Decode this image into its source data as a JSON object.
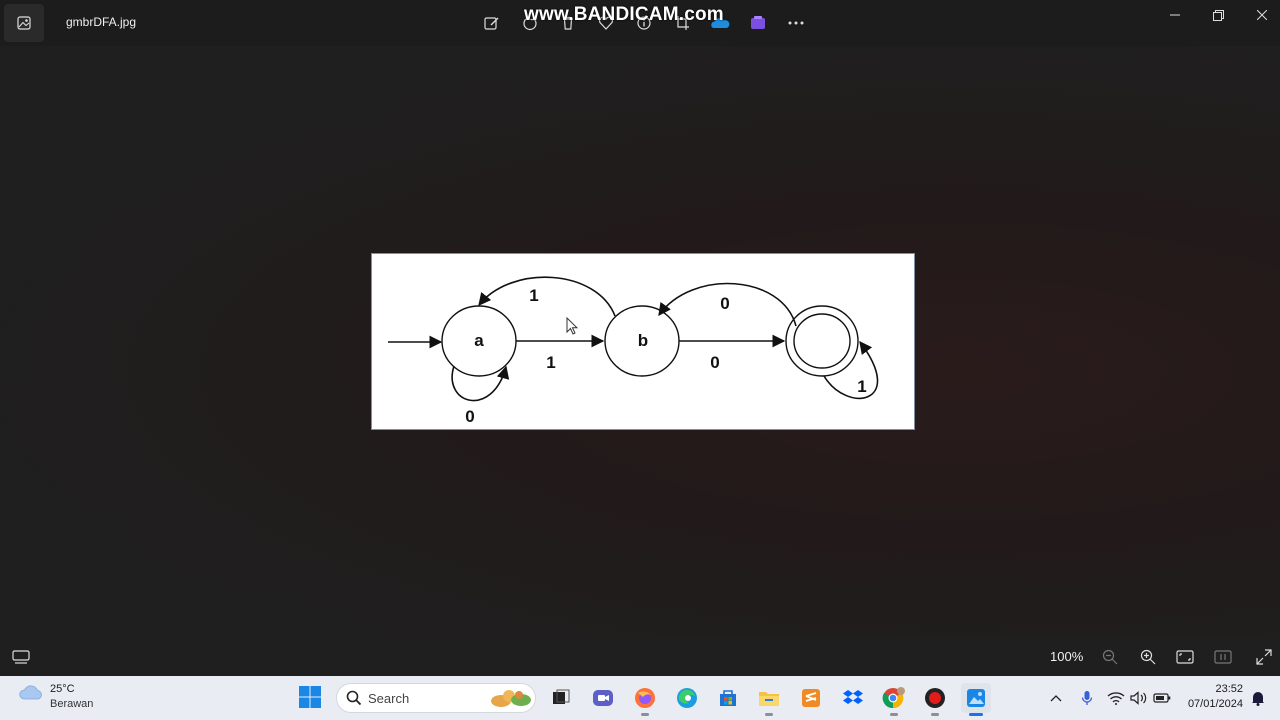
{
  "window": {
    "file_name": "gmbrDFA.jpg"
  },
  "watermark": "www.BANDICAM.com",
  "toolbar": [
    "edit-image-icon",
    "rotate-icon",
    "delete-icon",
    "favorite-icon",
    "info-icon",
    "crop-icon",
    "onedrive-icon",
    "clipchamp-icon",
    "more-icon"
  ],
  "dfa": {
    "states": [
      {
        "label": "a",
        "start": true,
        "accepting": false
      },
      {
        "label": "b",
        "start": false,
        "accepting": false
      },
      {
        "label": "",
        "start": false,
        "accepting": true
      }
    ],
    "transitions": [
      {
        "from": "a",
        "to": "a",
        "symbol": "0"
      },
      {
        "from": "a",
        "to": "b",
        "symbol": "1"
      },
      {
        "from": "b",
        "to": "a",
        "symbol": "1"
      },
      {
        "from": "b",
        "to": "final",
        "symbol": "0"
      },
      {
        "from": "final",
        "to": "b",
        "symbol": "0"
      },
      {
        "from": "final",
        "to": "final",
        "symbol": "1"
      }
    ],
    "labels": {
      "a_to_a": "0",
      "a_to_b": "1",
      "b_to_a": "1",
      "b_to_final": "0",
      "final_to_b": "0",
      "final_to_final": "1"
    }
  },
  "viewer": {
    "zoom": "100%"
  },
  "taskbar": {
    "weather": {
      "temp": "25°C",
      "condition": "Berawan"
    },
    "search_label": "Search",
    "clock": {
      "time": "23:52",
      "date": "07/01/2024"
    }
  }
}
